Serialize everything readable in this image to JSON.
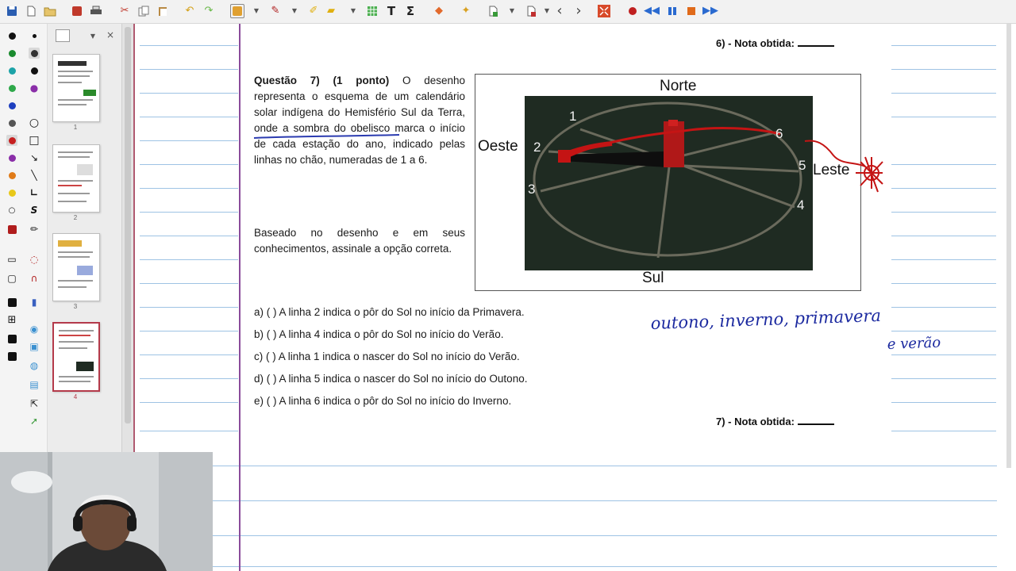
{
  "toolbar": {
    "icons": [
      "save-icon",
      "new-page-icon",
      "open-folder-icon",
      "pdf-icon",
      "printer-icon",
      "cut-icon",
      "copy-icon",
      "paste-icon",
      "undo-icon",
      "redo-icon",
      "pen-tool-icon",
      "marker-icon",
      "highlighter-icon",
      "shape-icon",
      "table-icon",
      "text-icon",
      "math-icon",
      "eraser-icon",
      "magic-icon",
      "insert-page-icon",
      "page-settings-icon",
      "prev-page-icon",
      "next-page-icon",
      "fit-page-icon",
      "record-icon",
      "rewind-icon",
      "play-icon",
      "stop-icon",
      "forward-icon"
    ],
    "text_tool": "T",
    "math_tool": "Σ",
    "prev": "‹",
    "next": "›"
  },
  "palette": {
    "colors": {
      "black": "#111111",
      "green": "#1a8a2e",
      "teal": "#1ca3a8",
      "blue": "#1e3fbf",
      "dark_gray": "#444444",
      "red": "#c62020",
      "purple": "#8a2ea8",
      "orange": "#e07b18",
      "yellow": "#e8c81a",
      "white": "#ffffff",
      "pink": "#d8388a",
      "sel_red": "#b01c1c"
    }
  },
  "thumbnails": [
    {
      "number": "1"
    },
    {
      "number": "2"
    },
    {
      "number": "3"
    },
    {
      "number": "4"
    }
  ],
  "page": {
    "grade6": {
      "label": "6) - Nota obtida:"
    },
    "grade7": {
      "label": "7) - Nota obtida:"
    },
    "question": {
      "title": "Questão 7) (1 ponto)",
      "body": " O desenho representa o esquema de um calendário solar indígena do Hemisfério Sul da Terra, onde a sombra do obelisco marca o início de cada estação do ano, indicado pelas linhas no chão, numeradas de 1 a 6."
    },
    "instruction": "Baseado no desenho e em seus conhecimentos, assinale a opção correta.",
    "options": [
      "a) (   ) A linha 2 indica o pôr do Sol no início da Primavera.",
      "b) (   ) A linha 4 indica o pôr do Sol no início do Verão.",
      "c) (   ) A linha 1 indica o nascer do Sol no início do Verão.",
      "d) (   ) A linha 5 indica o nascer do Sol no início do Outono.",
      "e) (   ) A linha 6 indica o pôr do Sol no início do Inverno."
    ],
    "figure": {
      "north": "Norte",
      "south": "Sul",
      "west": "Oeste",
      "east": "Leste",
      "line_numbers": [
        "1",
        "2",
        "3",
        "4",
        "5",
        "6"
      ]
    },
    "handwriting": {
      "line1": "outono, inverno, primavera",
      "line2": "e verão"
    }
  },
  "colors": {
    "rule": "#9ec3e4",
    "margin": "#8a4b9a",
    "ink_red": "#c41414",
    "ink_blue": "#1c2aa0",
    "diagram_bg": "#1f2b22"
  }
}
